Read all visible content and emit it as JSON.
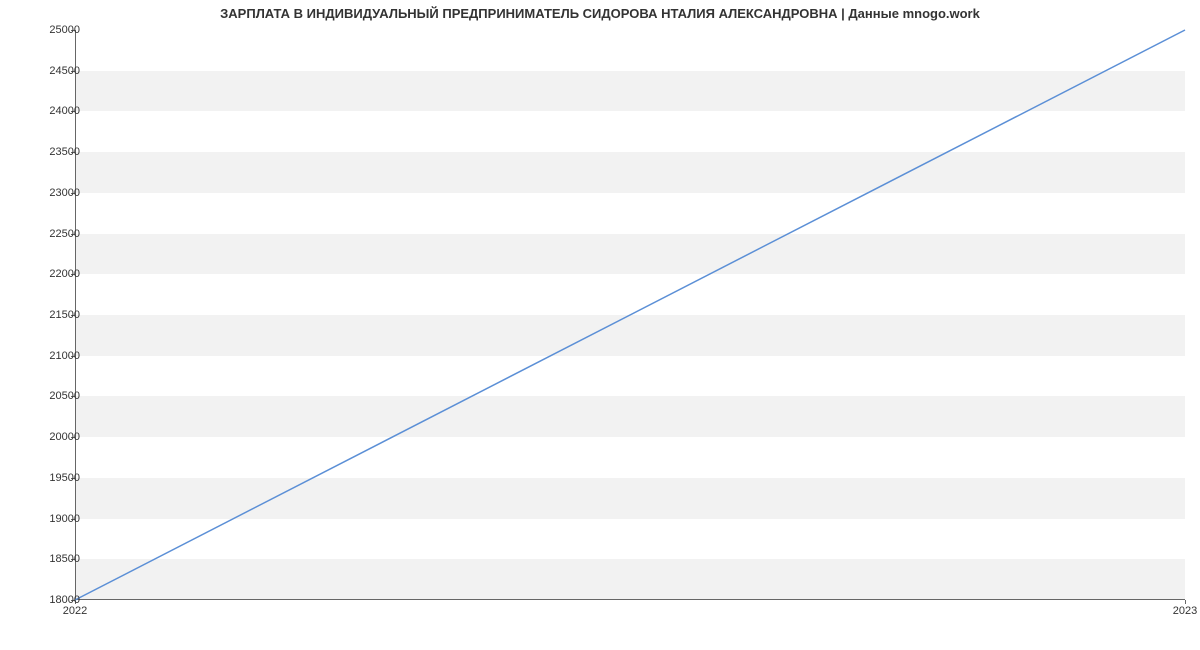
{
  "chart_data": {
    "type": "line",
    "title": "ЗАРПЛАТА В ИНДИВИДУАЛЬНЫЙ ПРЕДПРИНИМАТЕЛЬ СИДОРОВА НТАЛИЯ АЛЕКСАНДРОВНА | Данные mnogo.work",
    "x": [
      2022,
      2023
    ],
    "values": [
      18000,
      25000
    ],
    "x_tick_labels": [
      "2022",
      "2023"
    ],
    "y_ticks": [
      18000,
      18500,
      19000,
      19500,
      20000,
      20500,
      21000,
      21500,
      22000,
      22500,
      23000,
      23500,
      24000,
      24500,
      25000
    ],
    "xlabel": "",
    "ylabel": "",
    "xlim": [
      2022,
      2023
    ],
    "ylim": [
      18000,
      25000
    ],
    "line_color": "#5b8fd6"
  }
}
